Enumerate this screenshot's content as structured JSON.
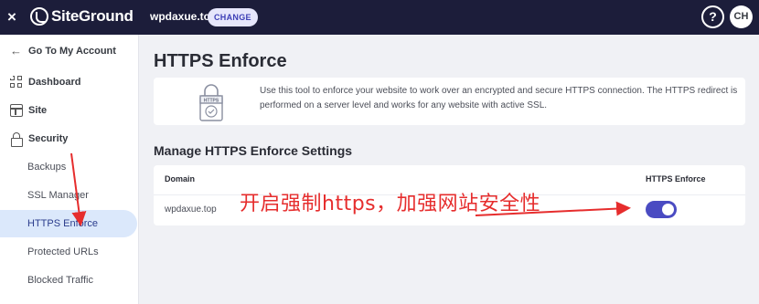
{
  "topbar": {
    "close_icon": "×",
    "logo_text": "SiteGround",
    "site_name": "wpdaxue.top",
    "change_label": "CHANGE",
    "help_icon": "?",
    "avatar_initials": "CH"
  },
  "sidebar": {
    "back_label": "Go To My Account",
    "items": [
      {
        "label": "Dashboard",
        "icon": "grid-icon"
      },
      {
        "label": "Site",
        "icon": "site-icon"
      },
      {
        "label": "Security",
        "icon": "lock-icon"
      }
    ],
    "sub_items": [
      {
        "label": "Backups"
      },
      {
        "label": "SSL Manager"
      },
      {
        "label": "HTTPS Enforce",
        "active": true
      },
      {
        "label": "Protected URLs"
      },
      {
        "label": "Blocked Traffic"
      }
    ]
  },
  "main": {
    "title": "HTTPS Enforce",
    "info": {
      "illustration_label": "HTTPS",
      "text": "Use this tool to enforce your website to work over an encrypted and secure HTTPS connection. The HTTPS redirect is performed on a server level and works for any website with active SSL."
    },
    "settings": {
      "title": "Manage HTTPS Enforce Settings",
      "columns": [
        "Domain",
        "HTTPS Enforce"
      ],
      "rows": [
        {
          "domain": "wpdaxue.top",
          "enforced": true
        }
      ]
    }
  },
  "annotation": {
    "text": "开启强制https，加强网站安全性",
    "color": "#e62d2d"
  },
  "colors": {
    "topbar_bg": "#1c1d3a",
    "accent": "#4a4bc2",
    "active_bg": "#dbe8fb"
  }
}
